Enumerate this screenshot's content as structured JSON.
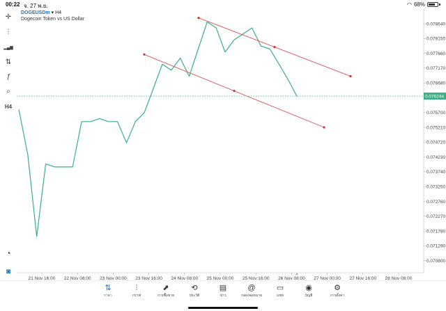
{
  "status_bar": {
    "time": "00:22",
    "date": "จ. 27 พ.ย.",
    "battery": "68%"
  },
  "symbol": {
    "name": "DOGEUSDm",
    "timeframe": "H4",
    "description": "Dogecoin Token vs US Dollar"
  },
  "left_toolbar": {
    "items": [
      {
        "name": "crosshair-icon",
        "glyph": "✛"
      },
      {
        "name": "candles-icon",
        "glyph": "⫶"
      },
      {
        "name": "bars-icon",
        "glyph": "▂▄▆"
      },
      {
        "name": "indicators-icon",
        "glyph": "⇅"
      },
      {
        "name": "function-icon",
        "glyph": "ƒ"
      },
      {
        "name": "objects-icon",
        "glyph": "⌕"
      },
      {
        "name": "period-label",
        "glyph": "H4"
      }
    ]
  },
  "price_axis": {
    "ticks": [
      "0.078640",
      "0.078150",
      "0.077660",
      "0.077170",
      "0.076680",
      "0.075700",
      "0.075210",
      "0.074720",
      "0.074230",
      "0.073740",
      "0.073250",
      "0.072760",
      "0.072270",
      "0.071780",
      "0.071290",
      "0.070800"
    ],
    "current_price": "0.076244"
  },
  "time_axis": {
    "ticks": [
      "21 Nov 16:00",
      "22 Nov 08:00",
      "23 Nov 00:00",
      "23 Nov 16:00",
      "24 Nov 08:00",
      "25 Nov 00:00",
      "25 Nov 16:00",
      "26 Nov 08:00",
      "27 Nov 00:00",
      "27 Nov 16:00",
      "28 Nov 08:00"
    ]
  },
  "chart_data": {
    "type": "line",
    "symbol": "DOGEUSDm",
    "timeframe": "H4",
    "y_axis_range": [
      0.0704,
      0.0791
    ],
    "x_axis_ticks": [
      "21 Nov 16:00",
      "22 Nov 08:00",
      "23 Nov 00:00",
      "23 Nov 16:00",
      "24 Nov 08:00",
      "25 Nov 00:00",
      "25 Nov 16:00",
      "26 Nov 08:00",
      "27 Nov 00:00",
      "27 Nov 16:00",
      "28 Nov 08:00"
    ],
    "price_series": [
      0.0758,
      0.0743,
      0.0716,
      0.074,
      0.0739,
      0.0739,
      0.0739,
      0.0754,
      0.0754,
      0.0755,
      0.0754,
      0.0754,
      0.0747,
      0.0754,
      0.0757,
      0.0765,
      0.0773,
      0.0771,
      0.0775,
      0.0769,
      0.0778,
      0.0787,
      0.0785,
      0.0777,
      0.0781,
      0.0783,
      0.0785,
      0.0779,
      0.0778,
      0.0773,
      0.0768,
      0.07624
    ],
    "current_price": 0.076244,
    "line_color": "#3aaf85",
    "trendline_color": "#e05555",
    "grid": true
  },
  "bottom_nav": {
    "items": [
      {
        "label": "ราคา",
        "name": "nav-quotes",
        "icon": "⇅",
        "active": true
      },
      {
        "label": "กราฟ",
        "name": "nav-chart",
        "icon": "⫶",
        "active": false
      },
      {
        "label": "การซื้อขาย",
        "name": "nav-trade",
        "icon": "⬈",
        "active": false
      },
      {
        "label": "ประวัติ",
        "name": "nav-history",
        "icon": "⟲",
        "active": false
      },
      {
        "label": "ข่าว",
        "name": "nav-news",
        "icon": "▤",
        "active": false
      },
      {
        "label": "กล่องจดหมาย",
        "name": "nav-mailbox",
        "icon": "@",
        "active": false
      },
      {
        "label": "แชท",
        "name": "nav-chat",
        "icon": "▭",
        "active": false
      },
      {
        "label": "บัญชี",
        "name": "nav-accounts",
        "icon": "◉",
        "active": false
      },
      {
        "label": "การตั้งค่า",
        "name": "nav-settings",
        "icon": "⚙",
        "active": false
      }
    ]
  }
}
